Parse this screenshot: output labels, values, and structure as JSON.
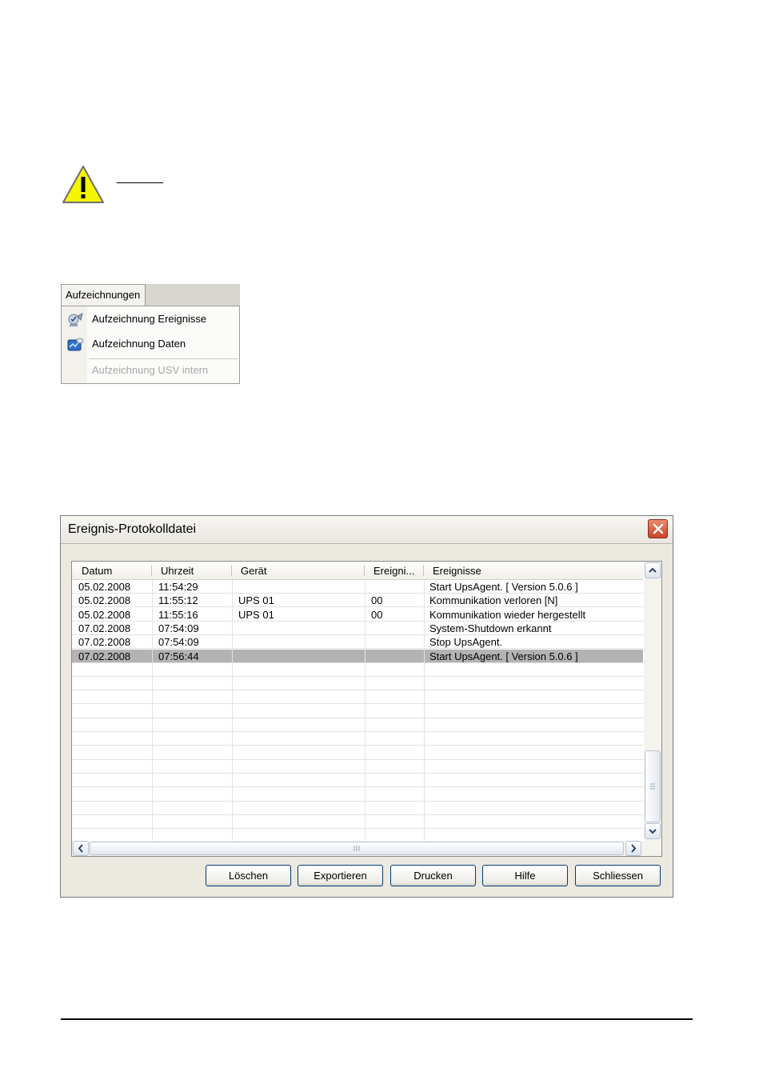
{
  "menu": {
    "tab_label": "Aufzeichnungen",
    "items": [
      {
        "label": "Aufzeichnung Ereignisse",
        "icon": "event-log-icon",
        "enabled": true
      },
      {
        "label": "Aufzeichnung Daten",
        "icon": "data-log-icon",
        "enabled": true
      },
      {
        "label": "Aufzeichnung USV intern",
        "icon": "",
        "enabled": false
      }
    ]
  },
  "dialog": {
    "title": "Ereignis-Protokolldatei",
    "columns": [
      "Datum",
      "Uhrzeit",
      "Gerät",
      "Ereigni...",
      "Ereignisse"
    ],
    "rows": [
      {
        "datum": "05.02.2008",
        "uhrzeit": "11:54:29",
        "geraet": "",
        "ereignis_nr": "",
        "ereignisse": "Start UpsAgent.   [ Version 5.0.6 ]",
        "selected": false
      },
      {
        "datum": "05.02.2008",
        "uhrzeit": "11:55:12",
        "geraet": "UPS 01",
        "ereignis_nr": "00",
        "ereignisse": "Kommunikation verloren [N]",
        "selected": false
      },
      {
        "datum": "05.02.2008",
        "uhrzeit": "11:55:16",
        "geraet": "UPS 01",
        "ereignis_nr": "00",
        "ereignisse": "Kommunikation wieder hergestellt",
        "selected": false
      },
      {
        "datum": "07.02.2008",
        "uhrzeit": "07:54:09",
        "geraet": "",
        "ereignis_nr": "",
        "ereignisse": "System-Shutdown erkannt",
        "selected": false
      },
      {
        "datum": "07.02.2008",
        "uhrzeit": "07:54:09",
        "geraet": "",
        "ereignis_nr": "",
        "ereignisse": "Stop UpsAgent.",
        "selected": false
      },
      {
        "datum": "07.02.2008",
        "uhrzeit": "07:56:44",
        "geraet": "",
        "ereignis_nr": "",
        "ereignisse": "Start UpsAgent.   [ Version 5.0.6 ]",
        "selected": true
      }
    ],
    "buttons": {
      "delete": "Löschen",
      "export": "Exportieren",
      "print": "Drucken",
      "help": "Hilfe",
      "close": "Schliessen"
    },
    "colors": {
      "selection": "#b3b3b3",
      "close_button": "#c8452a"
    }
  },
  "warning": {
    "icon": "warning-triangle-icon",
    "color": "#f5f500"
  }
}
